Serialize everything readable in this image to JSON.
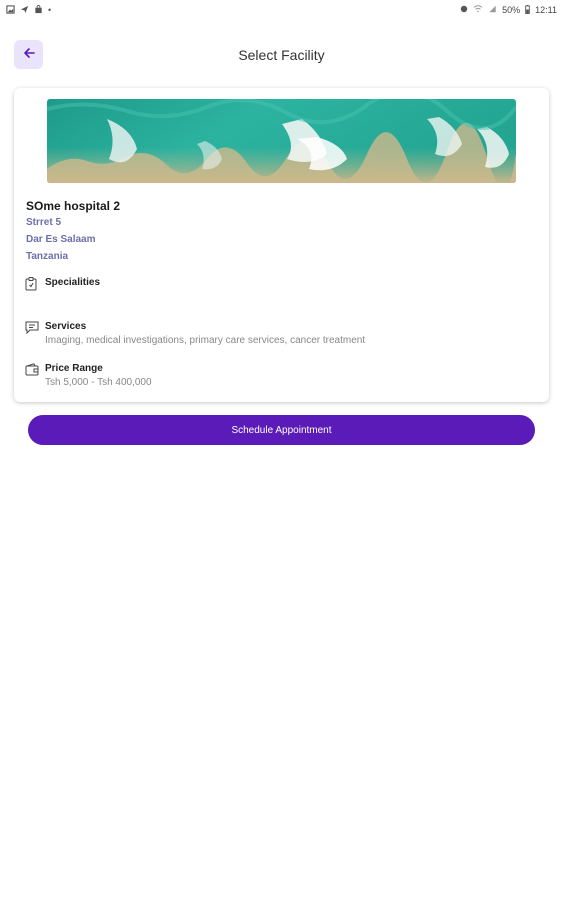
{
  "status_bar": {
    "battery": "50%",
    "time": "12:11"
  },
  "header": {
    "title": "Select Facility"
  },
  "facility": {
    "name": "SOme hospital 2",
    "street": "Strret 5",
    "city": "Dar Es Salaam",
    "country": "Tanzania",
    "specialities_label": "Specialities",
    "services_label": "Services",
    "services_value": "Imaging, medical investigations, primary care services, cancer treatment",
    "price_label": "Price Range",
    "price_value": "Tsh 5,000 - Tsh 400,000"
  },
  "actions": {
    "schedule_label": "Schedule Appointment"
  },
  "colors": {
    "primary": "#5b1bb8",
    "back_bg": "#e9e3fb",
    "address_text": "#6b6fa8"
  },
  "icons": {
    "back": "arrow-left-icon",
    "specialities": "clipboard-icon",
    "services": "chat-icon",
    "price": "wallet-icon"
  }
}
